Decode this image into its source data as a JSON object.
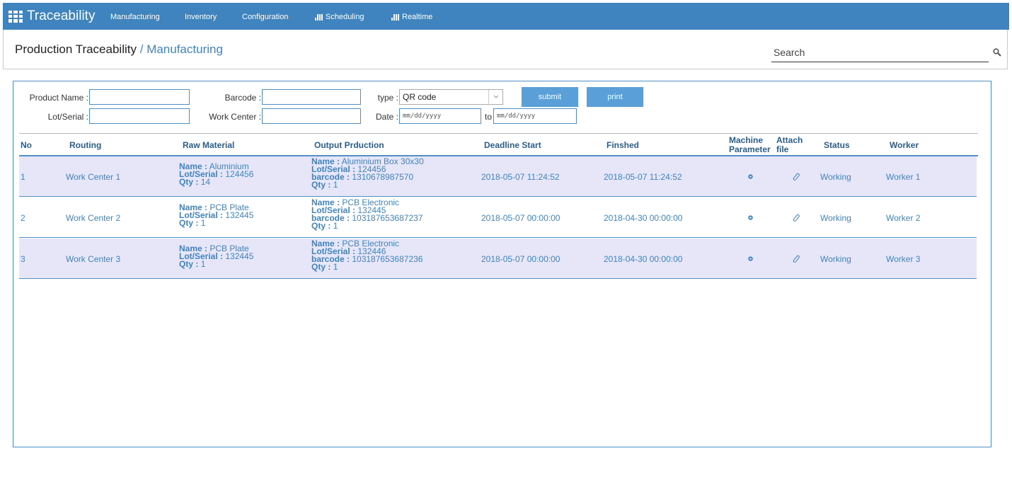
{
  "navbar": {
    "brand": "Traceability",
    "items": [
      {
        "label": "Manufacturing",
        "icon": ""
      },
      {
        "label": "Inventory",
        "icon": ""
      },
      {
        "label": "Configuration",
        "icon": ""
      },
      {
        "label": "Scheduling",
        "icon": "bar-chart-icon"
      },
      {
        "label": "Realtime",
        "icon": "bar-chart-icon"
      }
    ],
    "color": "#3f84bf"
  },
  "header": {
    "title": "Production Traceability",
    "separator": "/",
    "subtitle": "Manufacturing"
  },
  "search": {
    "placeholder": "Search",
    "icon": "search-icon"
  },
  "filters": {
    "product_name_label": "Product Name :",
    "lot_serial_label": "Lot/Serial :",
    "barcode_label": "Barcode :",
    "work_center_label": "Work Center :",
    "type_label": "type :",
    "type_value": "QR code",
    "date_label": "Date :",
    "date_from_placeholder": "mm/dd/yyyy",
    "to_label": "to",
    "date_to_placeholder": "mm/dd/yyyy",
    "submit_label": "submit",
    "print_label": "print"
  },
  "table": {
    "columns": {
      "no": "No",
      "routing": "Routing",
      "raw_material": "Raw Material",
      "output": "Output Prduction",
      "deadline_start": "Deadline Start",
      "finished": "Finshed",
      "machine_param_1": "Machine",
      "machine_param_2": "Parameter",
      "attach_1": "Attach",
      "attach_2": "file",
      "status": "Status",
      "worker": "Worker"
    },
    "labels": {
      "name": "Name :",
      "lot_serial": "Lot/Serial :",
      "qty": "Qty :",
      "barcode": "barcode :"
    },
    "rows": [
      {
        "no": "1",
        "routing": "Work Center 1",
        "raw_name": "Aluminium",
        "raw_lot": "124456",
        "raw_qty": "14",
        "out_name": "Aluminium Box 30x30",
        "out_lot": "124456",
        "out_barcode": "1310678987570",
        "out_qty": "1",
        "deadline_start": "2018-05-07 11:24:52",
        "finished": "2018-05-07 11:24:52",
        "status": "Working",
        "worker": "Worker 1"
      },
      {
        "no": "2",
        "routing": "Work Center 2",
        "raw_name": "PCB Plate",
        "raw_lot": "132445",
        "raw_qty": "1",
        "out_name": "PCB Electronic",
        "out_lot": "132445",
        "out_barcode": "103187653687237",
        "out_qty": "1",
        "deadline_start": "2018-05-07 00:00:00",
        "finished": "2018-04-30 00:00:00",
        "status": "Working",
        "worker": "Worker 2"
      },
      {
        "no": "3",
        "routing": "Work Center 3",
        "raw_name": "PCB Plate",
        "raw_lot": "132445",
        "raw_qty": "1",
        "out_name": "PCB Electronic",
        "out_lot": "132446",
        "out_barcode": "103187653687236",
        "out_qty": "1",
        "deadline_start": "2018-05-07 00:00:00",
        "finished": "2018-04-30 00:00:00",
        "status": "Working",
        "worker": "Worker 3"
      }
    ]
  }
}
